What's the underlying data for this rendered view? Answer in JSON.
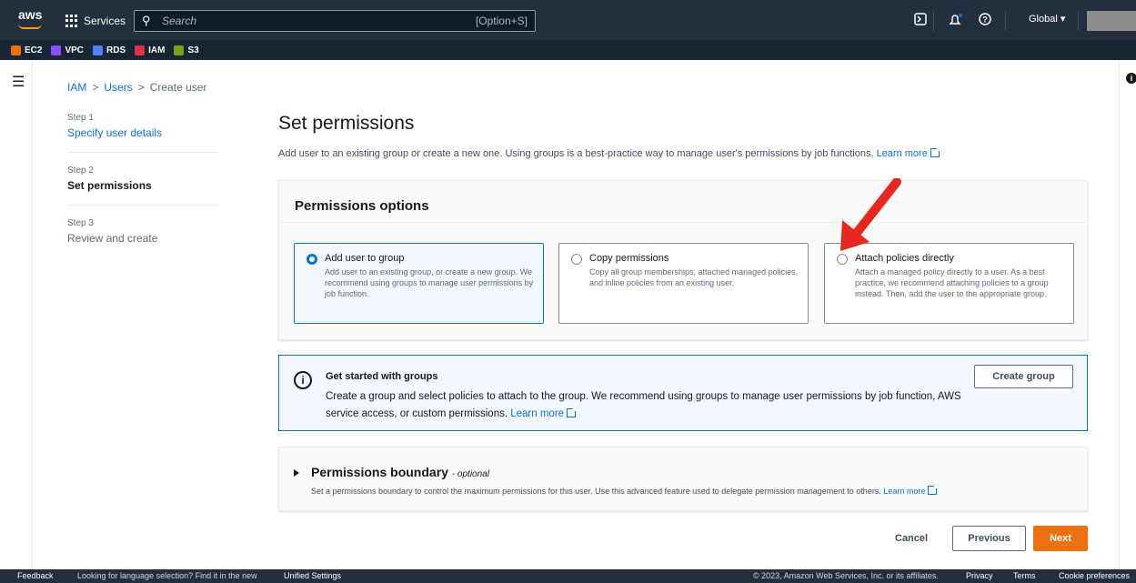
{
  "topbar": {
    "logo_text": "aws",
    "services_label": "Services",
    "search_placeholder": "Search",
    "search_shortcut": "[Option+S]",
    "region": "Global ▾"
  },
  "favorites": [
    {
      "label": "EC2",
      "color": "#ed7100"
    },
    {
      "label": "VPC",
      "color": "#8c4fff"
    },
    {
      "label": "RDS",
      "color": "#527fff"
    },
    {
      "label": "IAM",
      "color": "#dd344c"
    },
    {
      "label": "S3",
      "color": "#7aa116"
    }
  ],
  "breadcrumb": {
    "items": [
      "IAM",
      "Users"
    ],
    "separator": ">",
    "current": "Create user"
  },
  "steps": [
    {
      "num": "Step 1",
      "label": "Specify user details"
    },
    {
      "num": "Step 2",
      "label": "Set permissions"
    },
    {
      "num": "Step 3",
      "label": "Review and create"
    }
  ],
  "main": {
    "title": "Set permissions",
    "description": "Add user to an existing group or create a new one. Using groups is a best-practice way to manage user's permissions by job functions.",
    "learn_more": "Learn more"
  },
  "permissions_options": {
    "title": "Permissions options",
    "options": [
      {
        "title": "Add user to group",
        "desc": "Add user to an existing group, or create a new group. We recommend using groups to manage user permissions by job function.",
        "selected": true
      },
      {
        "title": "Copy permissions",
        "desc": "Copy all group memberships, attached managed policies, and inline policies from an existing user.",
        "selected": false
      },
      {
        "title": "Attach policies directly",
        "desc": "Attach a managed policy directly to a user. As a best practice, we recommend attaching policies to a group instead. Then, add the user to the appropriate group.",
        "selected": false
      }
    ]
  },
  "groups_info": {
    "title": "Get started with groups",
    "desc": "Create a group and select policies to attach to the group. We recommend using groups to manage user permissions by job function, AWS service access, or custom permissions.",
    "learn_more": "Learn more",
    "button": "Create group"
  },
  "boundary": {
    "title": "Permissions boundary",
    "optional": "- optional",
    "desc": "Set a permissions boundary to control the maximum permissions for this user. Use this advanced feature used to delegate permission management to others.",
    "learn_more": "Learn more"
  },
  "actions": {
    "cancel": "Cancel",
    "previous": "Previous",
    "next": "Next"
  },
  "footer": {
    "feedback": "Feedback",
    "lang_text": "Looking for language selection? Find it in the new",
    "unified": "Unified Settings",
    "copyright": "© 2023, Amazon Web Services, Inc. or its affiliates.",
    "privacy": "Privacy",
    "terms": "Terms",
    "cookies": "Cookie preferences"
  },
  "colors": {
    "accent": "#0972d3",
    "primary_button": "#ec7211",
    "annotation_arrow": "#e8281e"
  }
}
